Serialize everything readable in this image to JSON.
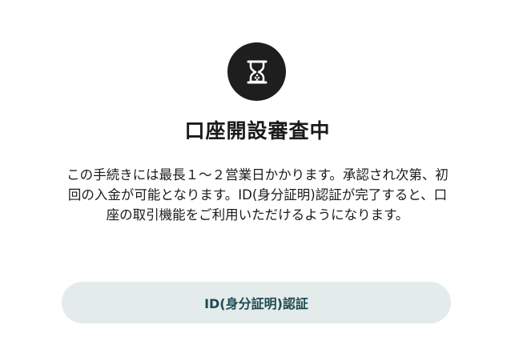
{
  "screen": {
    "title": "口座開設審査中",
    "description": "この手続きには最長１〜２営業日かかります。承認され次第、初回の入金が可能となります。ID(身分証明)認証が完了すると、口座の取引機能をご利用いただけるようになります。",
    "icon": "hourglass-icon"
  },
  "actions": {
    "id_verification_label": "ID(身分証明)認証"
  },
  "colors": {
    "icon_circle": "#1e1e1e",
    "icon_glyph": "#ffffff",
    "button_bg": "#e3ebeb",
    "button_text": "#1f4a52"
  }
}
